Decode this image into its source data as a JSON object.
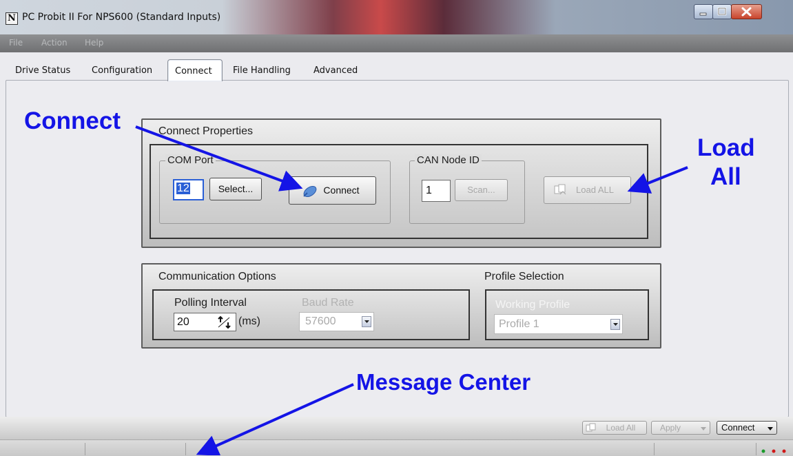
{
  "window": {
    "title": "PC Probit II  For NPS600 (Standard Inputs)",
    "app_icon_letter": "N"
  },
  "menu": [
    "File",
    "Action",
    "Help"
  ],
  "tabs": [
    "Drive Status",
    "Configuration",
    "Connect",
    "File Handling",
    "Advanced"
  ],
  "active_tab": "Connect",
  "connect_properties": {
    "title": "Connect Properties",
    "com_port": {
      "label": "COM Port",
      "value": "12",
      "select_button": "Select...",
      "connect_button": "Connect"
    },
    "can_node": {
      "label": "CAN Node ID",
      "value": "1",
      "scan_button": "Scan..."
    },
    "load_all_button": "Load ALL"
  },
  "communication_options": {
    "title": "Communication  Options",
    "polling_label": "Polling Interval",
    "polling_value": "20",
    "polling_unit": "(ms)",
    "baud_label": "Baud Rate",
    "baud_value": "57600"
  },
  "profile_selection": {
    "title": "Profile Selection",
    "working_label": "Working Profile",
    "working_value": "Profile 1"
  },
  "annotations": {
    "connect": "Connect",
    "load_all_line1": "Load",
    "load_all_line2": "All",
    "message_center": "Message Center",
    "color": "#1414e6"
  },
  "bottom_toolbar": {
    "load_all": "Load All",
    "apply": "Apply",
    "connect": "Connect"
  }
}
